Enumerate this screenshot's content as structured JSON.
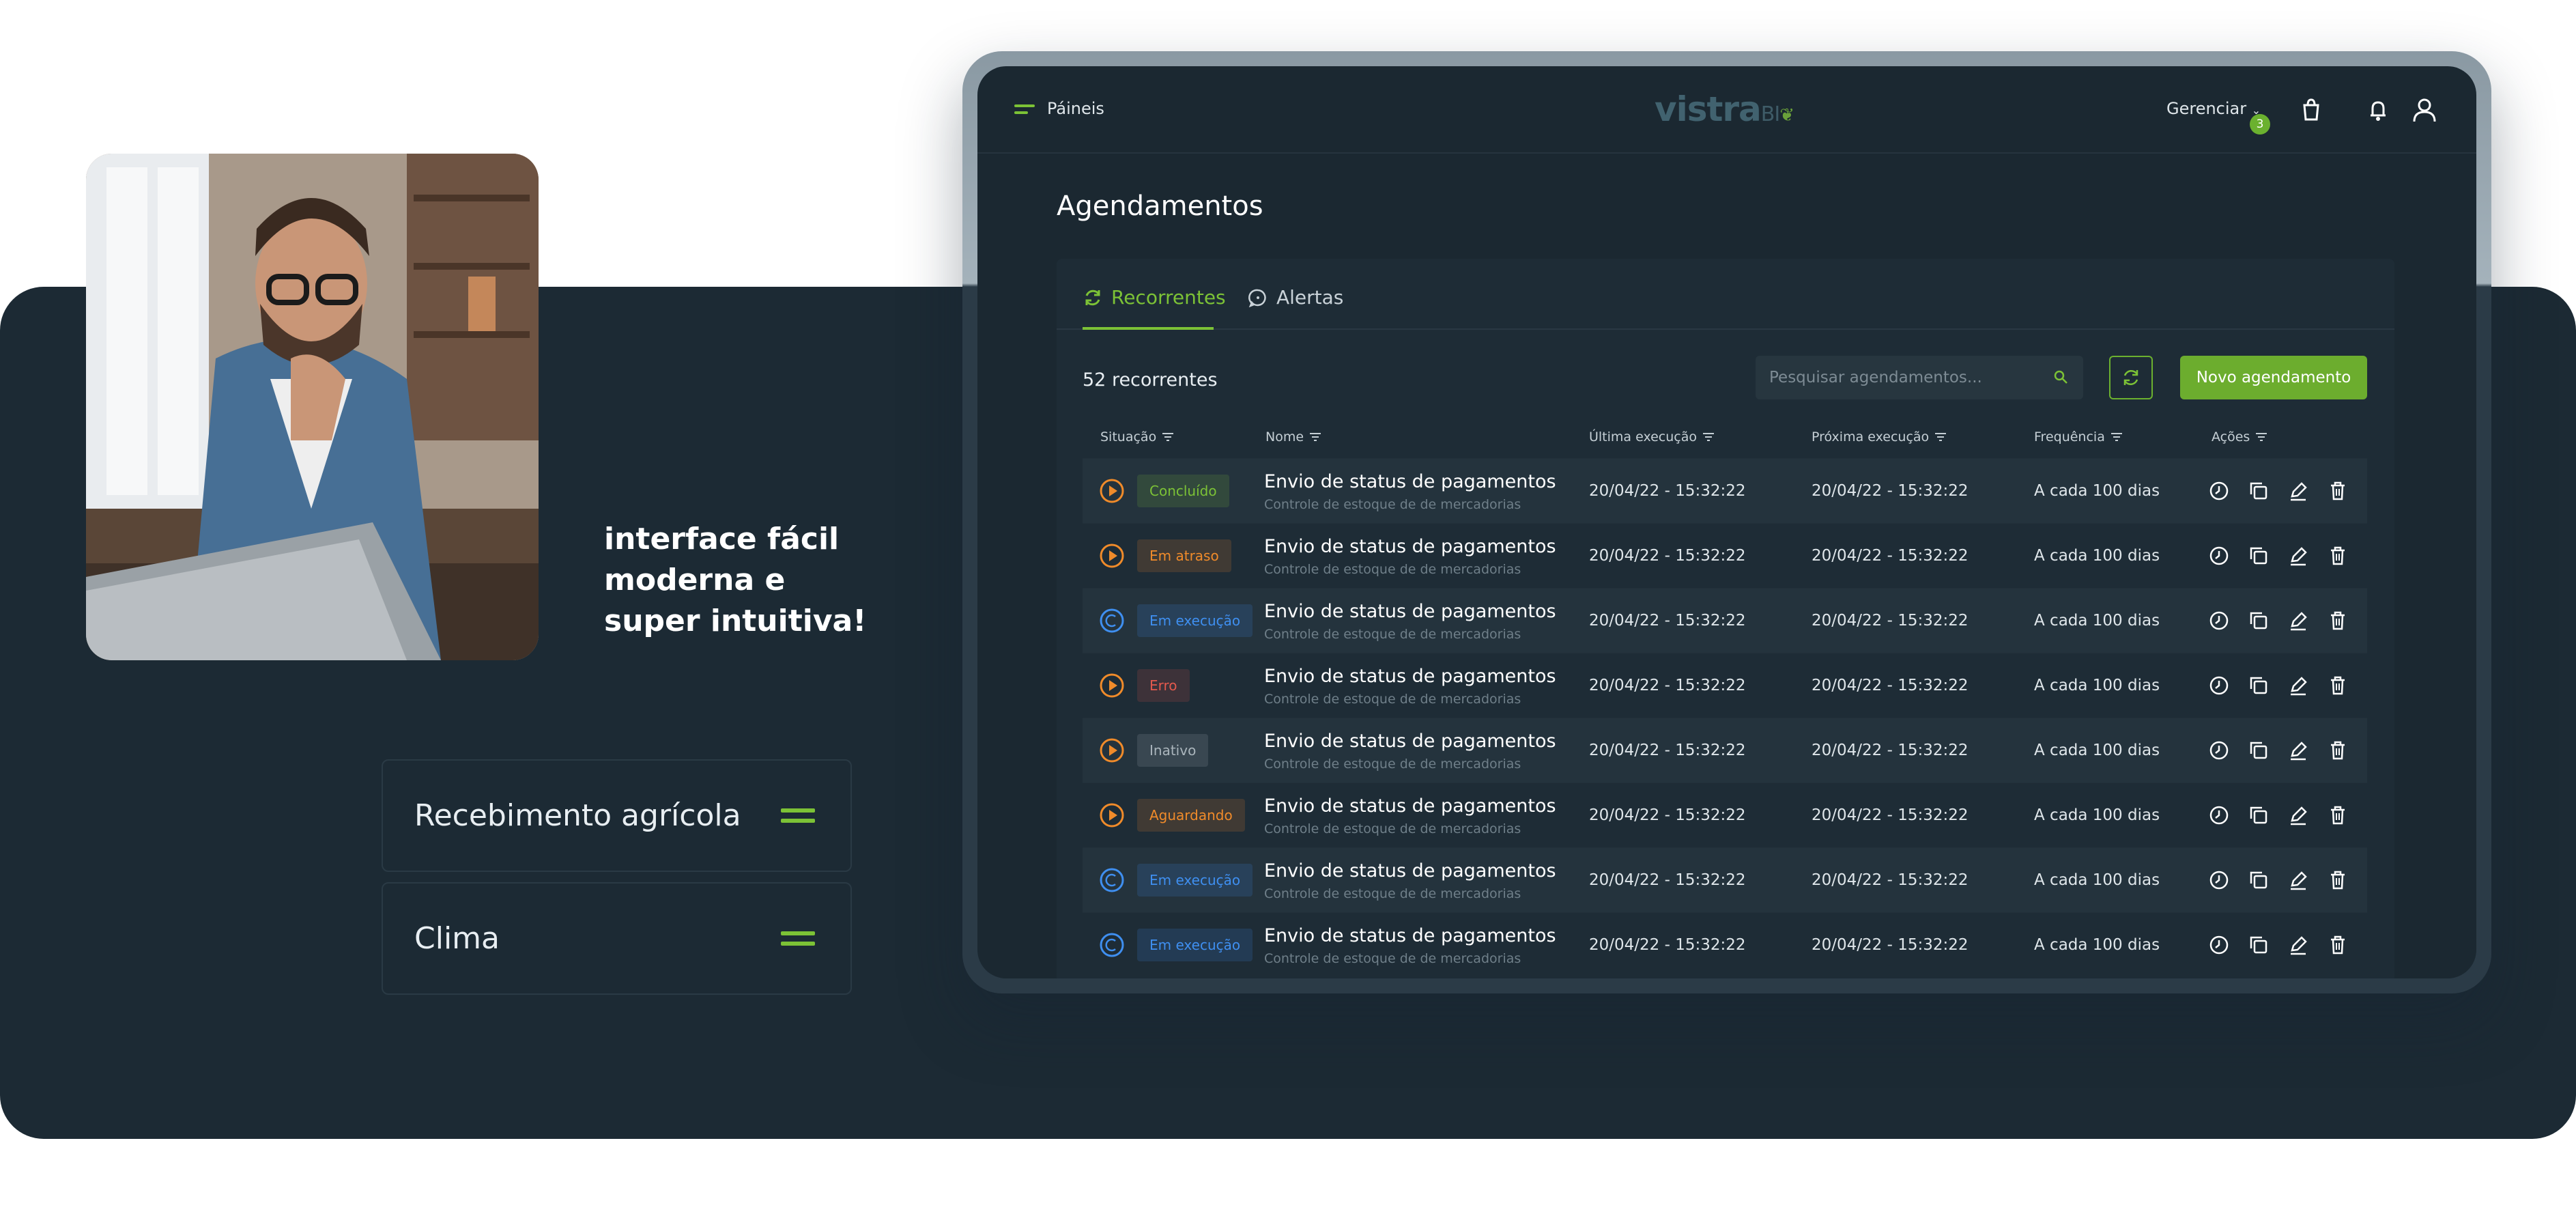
{
  "tagline": [
    "interface fácil",
    "moderna e",
    "super intuitiva!"
  ],
  "cards": [
    {
      "label": "Recebimento agrícola",
      "icon": "equals-icon"
    },
    {
      "label": "Clima",
      "icon": "equals-icon"
    }
  ],
  "app": {
    "menu_label": "Páineis",
    "logo_text": "vistra",
    "logo_suffix": "BI",
    "manage_label": "Gerenciar",
    "notification_count": "3",
    "page_title": "Agendamentos",
    "tabs": [
      {
        "label": "Recorrentes",
        "active": true
      },
      {
        "label": "Alertas",
        "active": false
      }
    ],
    "count_text": "52 recorrentes",
    "search_placeholder": "Pesquisar agendamentos...",
    "new_button": "Novo agendamento",
    "columns": [
      "Situação",
      "Nome",
      "Última execução",
      "Próxima execução",
      "Frequência",
      "Ações"
    ],
    "rows": [
      {
        "status": "Concluído",
        "status_color": "#7cc236",
        "icon": "play",
        "name": "Envio de status de pagamentos",
        "desc": "Controle de estoque de de mercadorias",
        "last": "20/04/22 - 15:32:22",
        "next": "20/04/22 - 15:32:22",
        "freq": "A cada 100 dias"
      },
      {
        "status": "Em atraso",
        "status_color": "#f08b2a",
        "icon": "play",
        "name": "Envio de status de pagamentos",
        "desc": "Controle de estoque de de mercadorias",
        "last": "20/04/22 - 15:32:22",
        "next": "20/04/22 - 15:32:22",
        "freq": "A cada 100 dias"
      },
      {
        "status": "Em execução",
        "status_color": "#3f8ff0",
        "icon": "running",
        "name": "Envio de status de pagamentos",
        "desc": "Controle de estoque de de mercadorias",
        "last": "20/04/22 - 15:32:22",
        "next": "20/04/22 - 15:32:22",
        "freq": "A cada 100 dias"
      },
      {
        "status": "Erro",
        "status_color": "#e3594d",
        "icon": "play",
        "name": "Envio de status de pagamentos",
        "desc": "Controle de estoque de de mercadorias",
        "last": "20/04/22 - 15:32:22",
        "next": "20/04/22 - 15:32:22",
        "freq": "A cada 100 dias"
      },
      {
        "status": "Inativo",
        "status_color": "#aab5bc",
        "icon": "play",
        "name": "Envio de status de pagamentos",
        "desc": "Controle de estoque de de mercadorias",
        "last": "20/04/22 - 15:32:22",
        "next": "20/04/22 - 15:32:22",
        "freq": "A cada 100 dias"
      },
      {
        "status": "Aguardando",
        "status_color": "#f08b2a",
        "icon": "play",
        "name": "Envio de status de pagamentos",
        "desc": "Controle de estoque de de mercadorias",
        "last": "20/04/22 - 15:32:22",
        "next": "20/04/22 - 15:32:22",
        "freq": "A cada 100 dias"
      },
      {
        "status": "Em execução",
        "status_color": "#3f8ff0",
        "icon": "running",
        "name": "Envio de status de pagamentos",
        "desc": "Controle de estoque de de mercadorias",
        "last": "20/04/22 - 15:32:22",
        "next": "20/04/22 - 15:32:22",
        "freq": "A cada 100 dias"
      },
      {
        "status": "Em execução",
        "status_color": "#3f8ff0",
        "icon": "running",
        "name": "Envio de status de pagamentos",
        "desc": "Controle de estoque de de mercadorias",
        "last": "20/04/22 - 15:32:22",
        "next": "20/04/22 - 15:32:22",
        "freq": "A cada 100 dias"
      }
    ],
    "row_actions": [
      "history-icon",
      "copy-icon",
      "edit-icon",
      "trash-icon"
    ]
  },
  "colors": {
    "accent": "#7cc236",
    "background": "#1c2a34"
  }
}
